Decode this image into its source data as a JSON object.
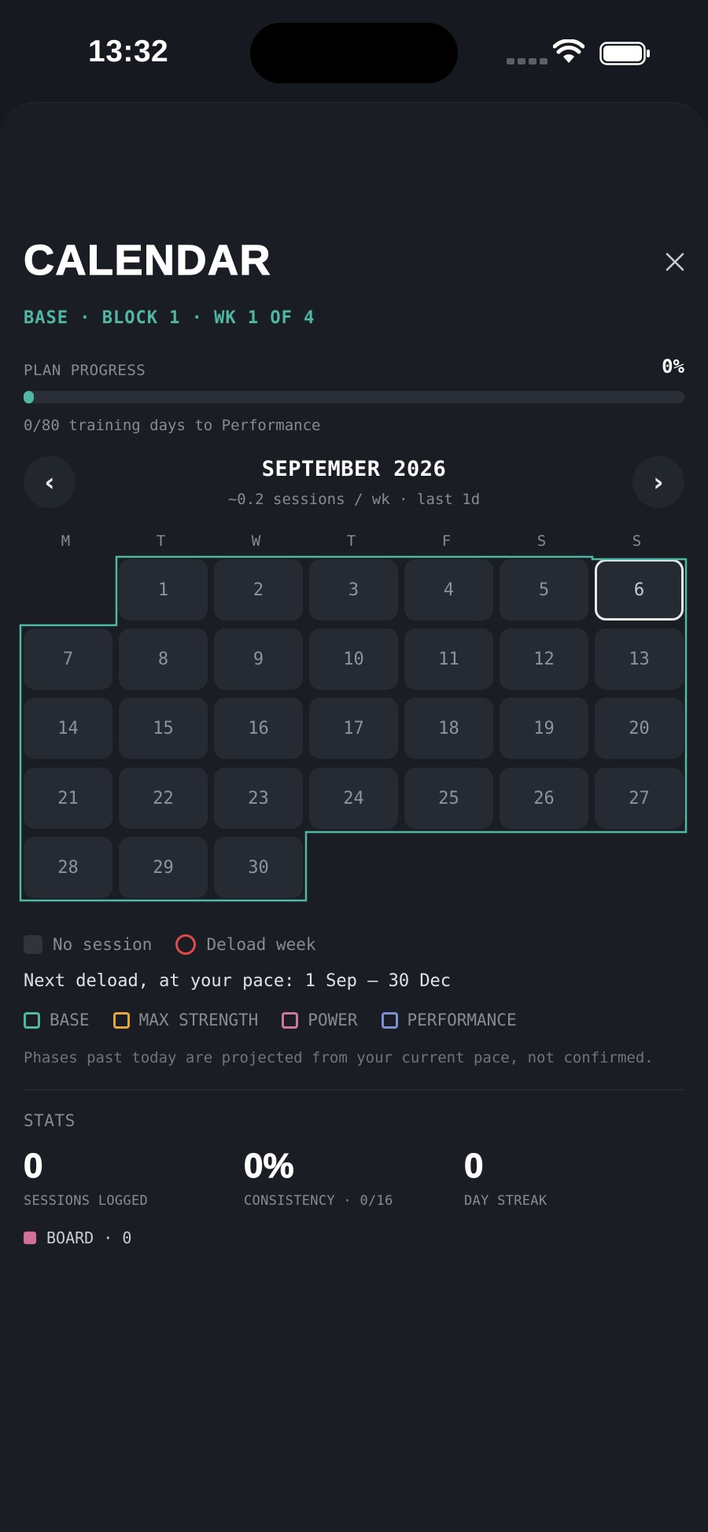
{
  "status_bar": {
    "time": "13:32"
  },
  "header": {
    "title": "CALENDAR",
    "subtitle": "BASE · BLOCK 1 · WK 1 OF 4"
  },
  "plan_progress": {
    "label": "PLAN PROGRESS",
    "percent_text": "0%",
    "fraction": 0.0,
    "note": "0/80 training days to Performance"
  },
  "month": {
    "title": "SEPTEMBER 2026",
    "subtitle": "~0.2 sessions / wk · last 1d",
    "prev_label": "‹",
    "next_label": "›",
    "weekdays": [
      "M",
      "T",
      "W",
      "T",
      "F",
      "S",
      "S"
    ],
    "days": [
      "1",
      "2",
      "3",
      "4",
      "5",
      "6",
      "7",
      "8",
      "9",
      "10",
      "11",
      "12",
      "13",
      "14",
      "15",
      "16",
      "17",
      "18",
      "19",
      "20",
      "21",
      "22",
      "23",
      "24",
      "25",
      "26",
      "27",
      "28",
      "29",
      "30"
    ],
    "today": "6",
    "phase_color": "#4fb7a4"
  },
  "legend": {
    "no_session": "No session",
    "deload_week": "Deload week",
    "next_deload": "Next deload, at your pace: 1 Sep – 30 Dec",
    "phases": [
      {
        "label": "BASE",
        "color": "#4fb7a4"
      },
      {
        "label": "MAX STRENGTH",
        "color": "#e3a93c"
      },
      {
        "label": "POWER",
        "color": "#c97a9c"
      },
      {
        "label": "PERFORMANCE",
        "color": "#7e8fd6"
      }
    ],
    "note": "Phases past today are projected from your current pace, not confirmed."
  },
  "stats": {
    "label": "STATS",
    "sessions_value": "0",
    "sessions_caption": "SESSIONS LOGGED",
    "consistency_value": "0%",
    "consistency_caption": "CONSISTENCY · 0/16",
    "streak_value": "0",
    "streak_caption": "DAY STREAK",
    "board_label": "BOARD · 0",
    "board_color": "#d0709a"
  },
  "colors": {
    "accent": "#4fb7a4",
    "background": "#16191f",
    "sheet": "#1a1d23",
    "deload": "#e04a4a"
  }
}
